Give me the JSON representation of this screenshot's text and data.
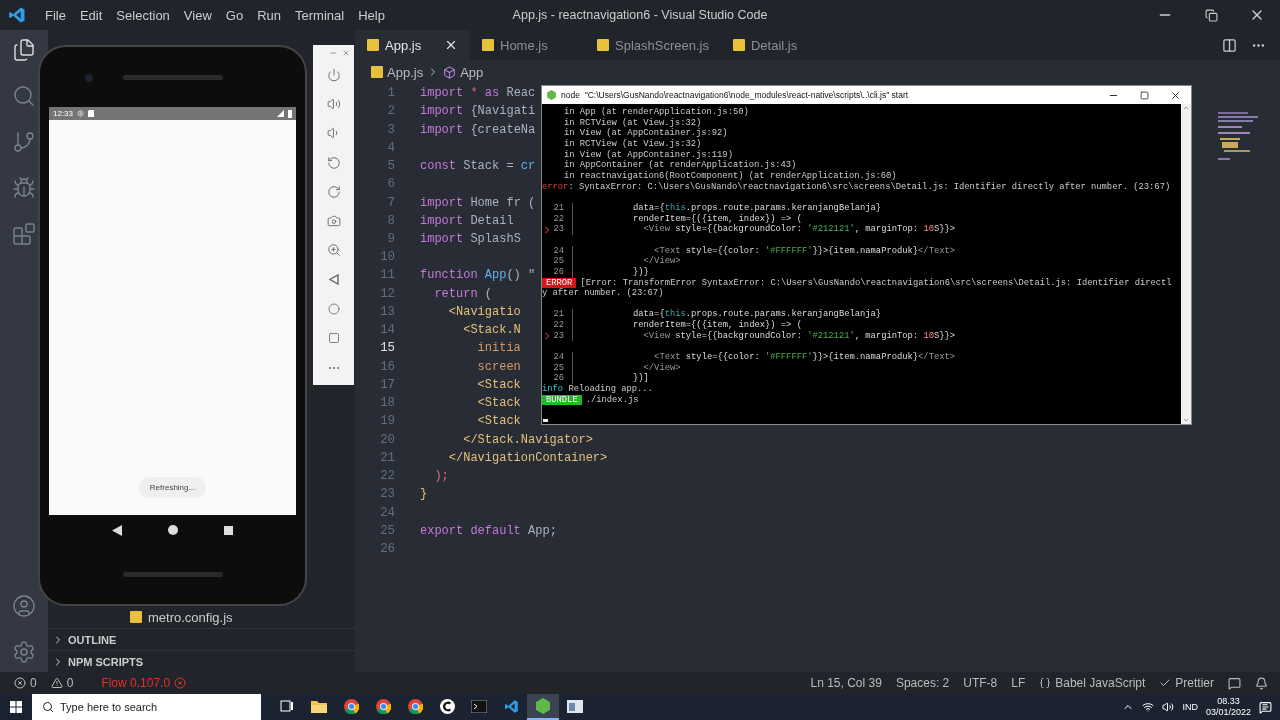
{
  "window": {
    "title": "App.js - reactnavigation6 - Visual Studio Code"
  },
  "menu": [
    "File",
    "Edit",
    "Selection",
    "View",
    "Go",
    "Run",
    "Terminal",
    "Help"
  ],
  "sidebar": {
    "file": "metro.config.js",
    "sections": [
      "OUTLINE",
      "NPM SCRIPTS"
    ]
  },
  "tabs": [
    {
      "label": "App.js",
      "selected": true
    },
    {
      "label": "Home.js",
      "selected": false
    },
    {
      "label": "SplashScreen.js",
      "selected": false
    },
    {
      "label": "Detail.js",
      "selected": false
    }
  ],
  "breadcrumb": [
    "App.js",
    "App"
  ],
  "lines": [
    {
      "number": "1",
      "active": false,
      "tokens": [
        {
          "kind": "kw",
          "s": "import"
        },
        {
          "kind": "op",
          "s": " * "
        },
        {
          "kind": "kw",
          "s": "as"
        },
        {
          "kind": "plain",
          "s": " Reac"
        }
      ]
    },
    {
      "number": "2",
      "active": false,
      "tokens": [
        {
          "kind": "kw",
          "s": "import"
        },
        {
          "kind": "plain",
          "s": " {Navigati"
        }
      ]
    },
    {
      "number": "3",
      "active": false,
      "tokens": [
        {
          "kind": "kw",
          "s": "import"
        },
        {
          "kind": "plain",
          "s": " {createNa"
        }
      ]
    },
    {
      "number": "4",
      "active": false
    },
    {
      "number": "5",
      "active": false,
      "tokens": [
        {
          "kind": "kw",
          "s": "const"
        },
        {
          "kind": "plain",
          "s": " Stack = "
        },
        {
          "kind": "fn",
          "s": "cr"
        }
      ]
    },
    {
      "number": "6",
      "active": false
    },
    {
      "number": "7",
      "active": false,
      "tokens": [
        {
          "kind": "kw",
          "s": "import"
        },
        {
          "kind": "plain",
          "s": " Home fr ("
        }
      ]
    },
    {
      "number": "8",
      "active": false,
      "tokens": [
        {
          "kind": "kw",
          "s": "import"
        },
        {
          "kind": "plain",
          "s": " Detail"
        }
      ]
    },
    {
      "number": "9",
      "active": false,
      "tokens": [
        {
          "kind": "kw",
          "s": "import"
        },
        {
          "kind": "plain",
          "s": " SplashS"
        }
      ]
    },
    {
      "number": "10",
      "active": false
    },
    {
      "number": "11",
      "active": false,
      "tokens": [
        {
          "kind": "kw",
          "s": "function"
        },
        {
          "kind": "fn",
          "s": " App"
        },
        {
          "kind": "plain",
          "s": "() \""
        }
      ]
    },
    {
      "number": "12",
      "active": false,
      "tokens": [
        {
          "kind": "kw",
          "s": "  return"
        },
        {
          "kind": "plain",
          "s": " ("
        }
      ]
    },
    {
      "number": "13",
      "active": false,
      "tokens": [
        {
          "kind": "tag",
          "s": "    <Navigatio"
        }
      ]
    },
    {
      "number": "14",
      "active": false,
      "tokens": [
        {
          "kind": "tag",
          "s": "      <Stack.N"
        }
      ]
    },
    {
      "number": "15",
      "active": true,
      "tokens": [
        {
          "kind": "attr",
          "s": "        initia"
        }
      ]
    },
    {
      "number": "16",
      "active": false,
      "tokens": [
        {
          "kind": "attr",
          "s": "        screen"
        }
      ]
    },
    {
      "number": "17",
      "active": false,
      "tokens": [
        {
          "kind": "tag",
          "s": "        <Stack"
        }
      ]
    },
    {
      "number": "18",
      "active": false,
      "tokens": [
        {
          "kind": "tag",
          "s": "        <Stack"
        }
      ]
    },
    {
      "number": "19",
      "active": false,
      "tokens": [
        {
          "kind": "tag",
          "s": "        <Stack"
        }
      ]
    },
    {
      "number": "20",
      "active": false,
      "tokens": [
        {
          "kind": "tag",
          "s": "      </Stack.Navigator>"
        }
      ]
    },
    {
      "number": "21",
      "active": false,
      "tokens": [
        {
          "kind": "tag",
          "s": "    </NavigationContainer>"
        }
      ]
    },
    {
      "number": "22",
      "active": false,
      "tokens": [
        {
          "kind": "op",
          "s": "  );"
        }
      ]
    },
    {
      "number": "23",
      "active": false,
      "tokens": [
        {
          "kind": "tag",
          "s": "}"
        }
      ]
    },
    {
      "number": "24",
      "active": false
    },
    {
      "number": "25",
      "active": false,
      "tokens": [
        {
          "kind": "kw",
          "s": "export default"
        },
        {
          "kind": "plain",
          "s": " App;"
        }
      ]
    },
    {
      "number": "26",
      "active": false
    }
  ],
  "terminal": {
    "title": "node  \"C:\\Users\\GusNando\\reactnavigation6\\node_modules\\react-native\\scripts\\..\\cli.js\" start",
    "lines": [
      {
        "kind": "trace",
        "text": "in App (at renderApplication.js:50)"
      },
      {
        "kind": "trace",
        "text": "in RCTView (at View.js:32)"
      },
      {
        "kind": "trace",
        "text": "in View (at AppContainer.js:92)"
      },
      {
        "kind": "trace",
        "text": "in RCTView (at View.js:32)"
      },
      {
        "kind": "trace",
        "text": "in View (at AppContainer.js:119)"
      },
      {
        "kind": "trace",
        "text": "in AppContainer (at renderApplication.js:43)"
      },
      {
        "kind": "trace",
        "text": "in reactnavigation6(RootComponent) (at renderApplication.js:60)"
      },
      {
        "kind": "error_inline",
        "label": "error",
        "text": ": SyntaxError: C:\\Users\\GusNando\\reactnavigation6\\src\\screens\\Detail.js: Identifier directly after number. (23:67)"
      },
      {
        "kind": "blank"
      },
      {
        "kind": "code",
        "number": "21",
        "marker": false,
        "tokens": [
          {
            "kind": "plain",
            "s": "data={"
          },
          {
            "kind": "kw",
            "s": "this"
          },
          {
            "kind": "plain",
            "s": ".props.route.params.keranjangBelanja}"
          }
        ]
      },
      {
        "kind": "code",
        "number": "22",
        "marker": false,
        "tokens": [
          {
            "kind": "plain",
            "s": "renderItem={({item, index}) => ("
          }
        ]
      },
      {
        "kind": "code",
        "number": "23",
        "marker": true,
        "tokens": [
          {
            "kind": "tag",
            "s": "  <View "
          },
          {
            "kind": "plain",
            "s": "style={{backgroundColor: "
          },
          {
            "kind": "str",
            "s": "'#212121'"
          },
          {
            "kind": "plain",
            "s": ", marginTop: "
          },
          {
            "kind": "bad",
            "s": "10"
          },
          {
            "kind": "plain",
            "s": "S}}>"
          }
        ]
      },
      {
        "kind": "blank"
      },
      {
        "kind": "code",
        "number": "24",
        "marker": false,
        "tokens": [
          {
            "kind": "tag",
            "s": "    <Text "
          },
          {
            "kind": "plain",
            "s": "style={{color: "
          },
          {
            "kind": "str",
            "s": "'#FFFFFF'"
          },
          {
            "kind": "plain",
            "s": "}}>{item.namaProduk}"
          },
          {
            "kind": "tag",
            "s": "</Text>"
          }
        ]
      },
      {
        "kind": "code",
        "number": "25",
        "marker": false,
        "tokens": [
          {
            "kind": "tag",
            "s": "  </View>"
          }
        ]
      },
      {
        "kind": "code",
        "number": "26",
        "marker": false,
        "tokens": [
          {
            "kind": "plain",
            "s": "})}"
          }
        ]
      },
      {
        "kind": "error_badge",
        "label": "ERROR",
        "text": "[Error: TransformError SyntaxError: C:\\Users\\GusNando\\reactnavigation6\\src\\screens\\Detail.js: Identifier directl"
      },
      {
        "kind": "wrap",
        "text": "y after number. (23:67)"
      },
      {
        "kind": "blank"
      },
      {
        "kind": "code",
        "number": "21",
        "marker": false,
        "tokens": [
          {
            "kind": "plain",
            "s": "data={"
          },
          {
            "kind": "kw",
            "s": "this"
          },
          {
            "kind": "plain",
            "s": ".props.route.params.keranjangBelanja}"
          }
        ]
      },
      {
        "kind": "code",
        "number": "22",
        "marker": false,
        "tokens": [
          {
            "kind": "plain",
            "s": "renderItem={({item, index}) => ("
          }
        ]
      },
      {
        "kind": "code",
        "number": "23",
        "marker": true,
        "tokens": [
          {
            "kind": "tag",
            "s": "  <View "
          },
          {
            "kind": "plain",
            "s": "style={{backgroundColor: "
          },
          {
            "kind": "str",
            "s": "'#212121'"
          },
          {
            "kind": "plain",
            "s": ", marginTop: "
          },
          {
            "kind": "bad",
            "s": "10"
          },
          {
            "kind": "plain",
            "s": "S}}>"
          }
        ]
      },
      {
        "kind": "blank"
      },
      {
        "kind": "code",
        "number": "24",
        "marker": false,
        "tokens": [
          {
            "kind": "tag",
            "s": "    <Text "
          },
          {
            "kind": "plain",
            "s": "style={{color: "
          },
          {
            "kind": "str",
            "s": "'#FFFFFF'"
          },
          {
            "kind": "plain",
            "s": "}}>{item.namaProduk}"
          },
          {
            "kind": "tag",
            "s": "</Text>"
          }
        ]
      },
      {
        "kind": "code",
        "number": "25",
        "marker": false,
        "tokens": [
          {
            "kind": "tag",
            "s": "  </View>"
          }
        ]
      },
      {
        "kind": "code",
        "number": "26",
        "marker": false,
        "tokens": [
          {
            "kind": "plain",
            "s": "})]"
          }
        ]
      },
      {
        "kind": "info",
        "label": "info",
        "text": " Reloading app..."
      },
      {
        "kind": "bundle",
        "label": "BUNDLE",
        "text": "./index.js"
      }
    ]
  },
  "emulator": {
    "time": "12:33",
    "toast": "Refreshing..."
  },
  "status_bar": {
    "errors": "0",
    "warnings": "0",
    "flow": "Flow 0.107.0",
    "items": [
      {
        "kind": "text",
        "text": "Ln 15, Col 39"
      },
      {
        "kind": "text",
        "text": "Spaces: 2"
      },
      {
        "kind": "text",
        "text": "UTF-8"
      },
      {
        "kind": "text",
        "text": "LF"
      },
      {
        "kind": "language",
        "text": "Babel JavaScript"
      },
      {
        "kind": "formatter",
        "text": "Prettier"
      }
    ]
  },
  "taskbar": {
    "search": {
      "placeholder": "Type here to search"
    },
    "apps": [
      {
        "kind": "taskview",
        "selected": false
      },
      {
        "kind": "folder",
        "selected": false
      },
      {
        "kind": "chrome",
        "selected": false
      },
      {
        "kind": "chrome",
        "selected": false
      },
      {
        "kind": "chrome",
        "selected": false
      },
      {
        "kind": "circle",
        "selected": false
      },
      {
        "kind": "console",
        "selected": false
      },
      {
        "kind": "vscode",
        "selected": false
      },
      {
        "kind": "node",
        "selected": true
      },
      {
        "kind": "window",
        "selected": false
      }
    ],
    "language": "IND",
    "time": "08.33",
    "date": "03/01/2022"
  }
}
